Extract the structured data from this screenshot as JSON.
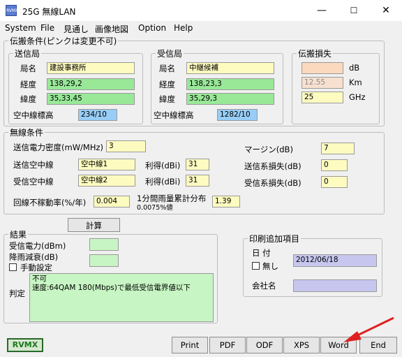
{
  "window": {
    "title": "25G 無線LAN",
    "icon_text": "RVMX",
    "minimize": "—",
    "maximize": "☐",
    "close": "✕"
  },
  "menu": [
    "System",
    "File",
    "見通し",
    "画像地図",
    "Option",
    "Help"
  ],
  "propagation": {
    "title": "伝搬条件(ピンクは変更不可)",
    "tx": {
      "title": "送信局",
      "name_label": "局名",
      "name": "建設事務所",
      "lon_label": "経度",
      "lon": "138,29,2",
      "lat_label": "緯度",
      "lat": "35,33,45",
      "height_label": "空中線標高",
      "height": "234/10"
    },
    "rx": {
      "title": "受信局",
      "name_label": "局名",
      "name": "中継候補",
      "lon_label": "経度",
      "lon": "138,23,3",
      "lat_label": "緯度",
      "lat": "35,29,3",
      "height_label": "空中線標高",
      "height": "1282/10"
    },
    "loss": {
      "title": "伝搬損失",
      "db_value": "",
      "db_unit": "dB",
      "km_value": "12.55",
      "km_unit": "Km",
      "ghz_value": "25",
      "ghz_unit": "GHz"
    }
  },
  "radio": {
    "title": "無線条件",
    "tx_power_label": "送信電力密度(mW/MHz)",
    "tx_power": "3",
    "tx_ant_label": "送信空中線",
    "tx_ant": "空中線1",
    "tx_gain_label": "利得(dBi)",
    "tx_gain": "31",
    "rx_ant_label": "受信空中線",
    "rx_ant": "空中線2",
    "rx_gain_label": "利得(dBi)",
    "rx_gain": "31",
    "margin_label": "マージン(dB)",
    "margin": "7",
    "tx_loss_label": "送信系損失(dB)",
    "tx_loss": "0",
    "rx_loss_label": "受信系損失(dB)",
    "rx_loss": "0",
    "outage_label": "回線不稼動率(%/年)",
    "outage": "0.004",
    "rain_label": "1分間雨量累計分布",
    "rain_sub": "0.0075%値",
    "rain": "1.39"
  },
  "calc_button": "計算",
  "result": {
    "title": "結果",
    "rx_power_label": "受信電力(dBm)",
    "rx_power": "",
    "rain_atten_label": "降雨減衰(dB)",
    "rain_atten": "",
    "manual_label": "手動設定",
    "judge_label": "判定",
    "judge_lines": [
      "不可",
      "速度:64QAM 180(Mbps)で最低受信電界値以下"
    ]
  },
  "print_extra": {
    "title": "印刷追加項目",
    "date_label": "日 付",
    "none_label": "無し",
    "date": "2012/06/18",
    "company_label": "会社名",
    "company": ""
  },
  "footer": {
    "brand": "RVMX",
    "buttons": [
      "Print",
      "PDF",
      "ODF",
      "XPS",
      "Word",
      "End"
    ]
  },
  "colors": {
    "yellow": "#fdfbc0",
    "green": "#98e898",
    "blue": "#97cdf6",
    "pink": "#fbd9be",
    "lavender": "#c6c6ef",
    "arrow": "#e02020"
  }
}
